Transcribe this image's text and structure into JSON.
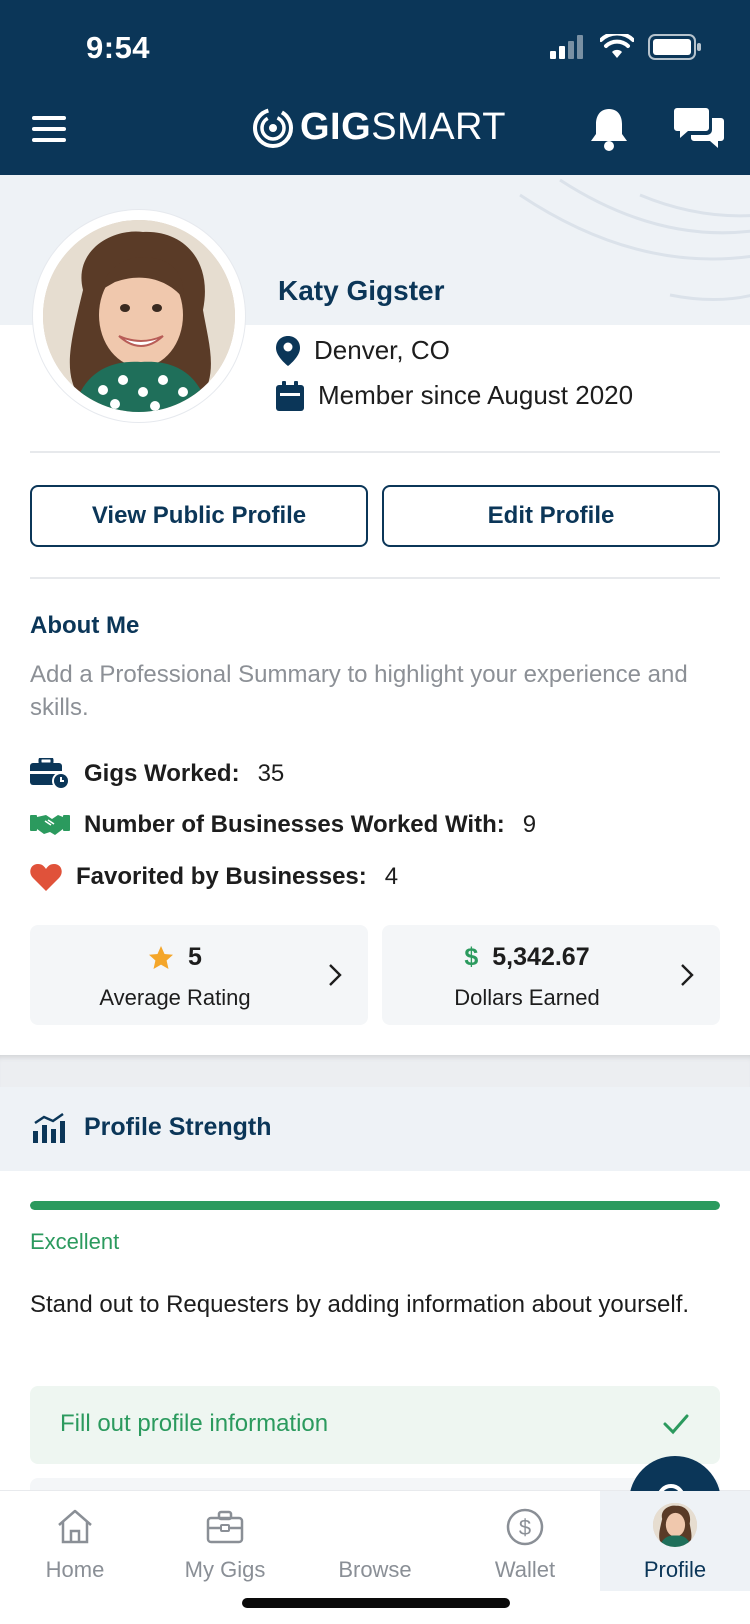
{
  "status_bar": {
    "time": "9:54"
  },
  "header": {
    "logo_bold": "GIG",
    "logo_light": "SMART"
  },
  "profile": {
    "name": "Katy Gigster",
    "location": "Denver, CO",
    "member_since": "Member since August 2020",
    "view_public_label": "View Public Profile",
    "edit_label": "Edit Profile"
  },
  "about": {
    "title": "About Me",
    "placeholder_text": "Add a Professional Summary to highlight your experience and skills."
  },
  "stats": {
    "gigs_worked_label": "Gigs Worked:",
    "gigs_worked_value": "35",
    "businesses_label": "Number of Businesses Worked With:",
    "businesses_value": "9",
    "favorited_label": "Favorited by Businesses:",
    "favorited_value": "4"
  },
  "tiles": {
    "rating_value": "5",
    "rating_label": "Average Rating",
    "dollar_sign": "$",
    "earned_value": "5,342.67",
    "earned_label": "Dollars Earned"
  },
  "profile_strength": {
    "title": "Profile Strength",
    "progress_fraction": 1.0,
    "level": "Excellent",
    "description": "Stand out to Requesters by adding information about yourself.",
    "tasks": [
      {
        "label": "Fill out profile information",
        "done": true
      }
    ]
  },
  "bottom_nav": {
    "items": [
      {
        "label": "Home",
        "icon": "home-icon"
      },
      {
        "label": "My Gigs",
        "icon": "briefcase-icon"
      },
      {
        "label": "Browse",
        "icon": "search-icon"
      },
      {
        "label": "Wallet",
        "icon": "dollar-circle-icon"
      },
      {
        "label": "Profile",
        "icon": "avatar"
      }
    ],
    "active": "Profile"
  },
  "colors": {
    "brand_navy": "#0b3658",
    "success_green": "#2b9a5e",
    "star_orange": "#f4a62a",
    "heart_red": "#e0523a"
  }
}
